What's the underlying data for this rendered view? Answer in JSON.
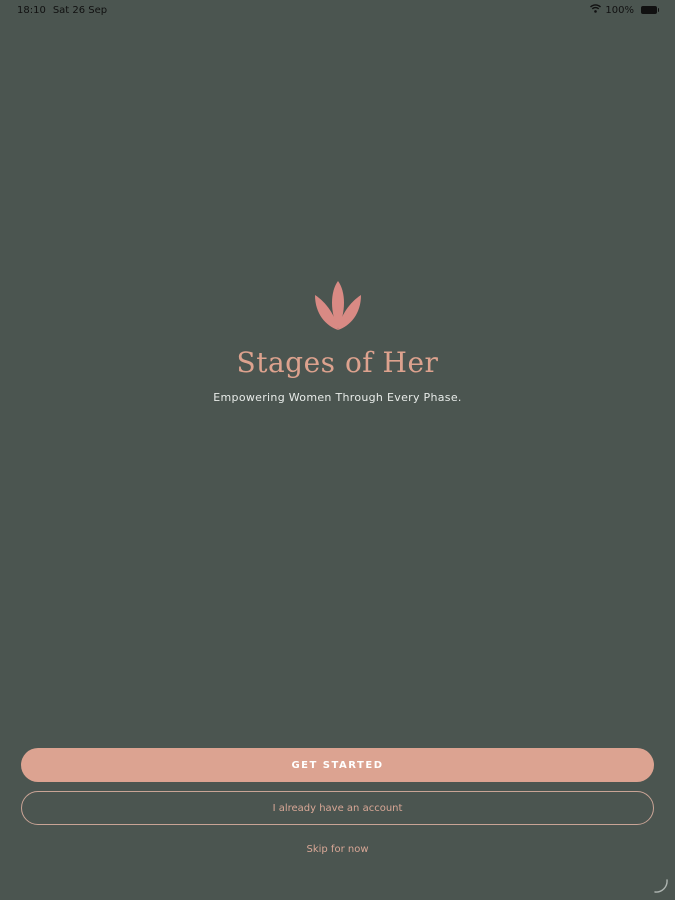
{
  "status_bar": {
    "time": "18:10",
    "date": "Sat 26 Sep",
    "battery": "100%",
    "icons": [
      "wifi-icon",
      "battery-icon"
    ]
  },
  "hero": {
    "logo_icon": "lotus-icon",
    "title": "Stages of Her",
    "tagline": "Empowering Women Through Every Phase."
  },
  "actions": {
    "get_started": "GET STARTED",
    "have_account": "I already have an account",
    "skip": "Skip for now"
  },
  "colors": {
    "background": "#4b5550",
    "accent": "#dca391",
    "text_light": "#e8ece9"
  }
}
